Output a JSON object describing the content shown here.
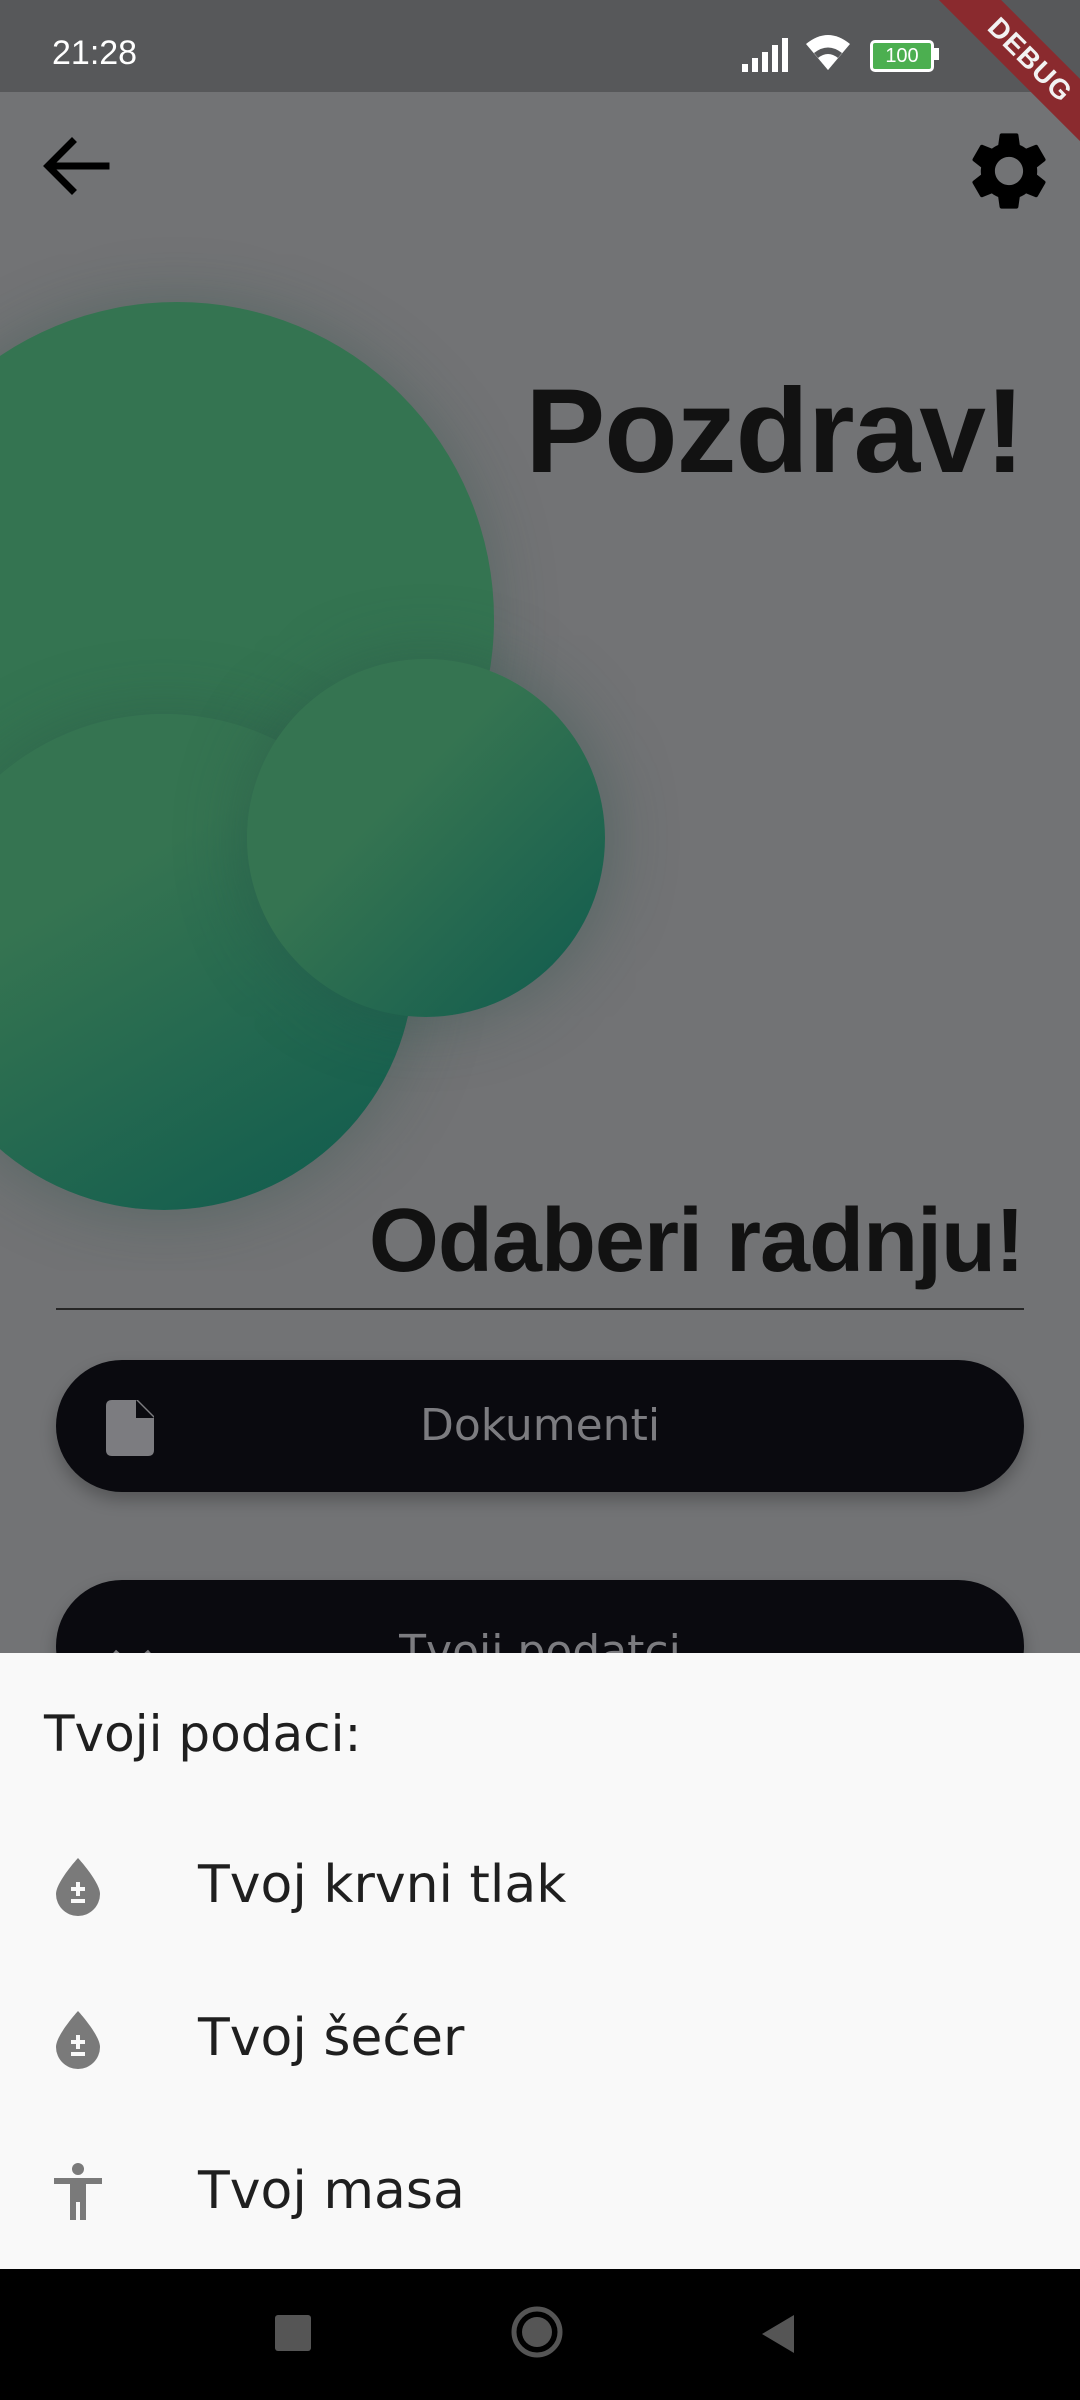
{
  "status_bar": {
    "time": "21:28",
    "battery_level": "100",
    "debug_label": "DEBUG"
  },
  "app_bar": {
    "back_icon": "arrow-back-icon",
    "settings_icon": "gear-icon"
  },
  "main": {
    "greeting": "Pozdrav!",
    "choose_action": "Odaberi radnju!",
    "buttons": [
      {
        "label": "Dokumenti",
        "icon": "document-icon"
      },
      {
        "label": "Tvoji podatci",
        "icon": "chevron-down-icon"
      }
    ]
  },
  "bottom_sheet": {
    "title": "Tvoji podaci:",
    "items": [
      {
        "label": "Tvoj krvni tlak",
        "icon": "blood-drop-icon"
      },
      {
        "label": "Tvoj šećer",
        "icon": "blood-drop-icon"
      },
      {
        "label": "Tvoj masa",
        "icon": "accessibility-icon"
      }
    ]
  },
  "colors": {
    "scrim": "#727375",
    "accent_green": "#347451",
    "dark_teal": "#0e5a4e",
    "button_bg": "#0a0a0f",
    "sheet_bg": "#f9f9f9"
  }
}
